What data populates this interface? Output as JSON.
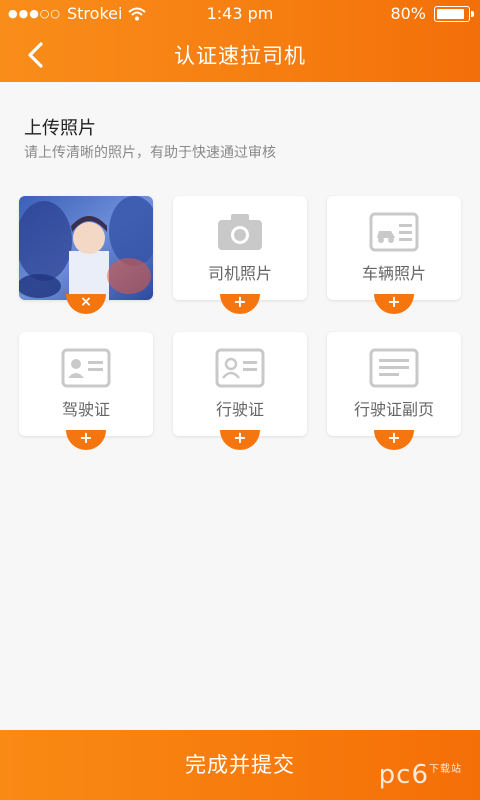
{
  "status": {
    "carrier": "Strokei",
    "time": "1:43 pm",
    "battery": "80%",
    "battery_level": 0.8
  },
  "nav": {
    "title": "认证速拉司机"
  },
  "upload": {
    "title": "上传照片",
    "subtitle": "请上传清晰的照片，有助于快速通过审核"
  },
  "tiles": [
    {
      "label": "",
      "badge": "×",
      "state": "uploaded"
    },
    {
      "label": "司机照片",
      "badge": "+"
    },
    {
      "label": "车辆照片",
      "badge": "+"
    },
    {
      "label": "驾驶证",
      "badge": "+"
    },
    {
      "label": "行驶证",
      "badge": "+"
    },
    {
      "label": "行驶证副页",
      "badge": "+"
    }
  ],
  "footer": {
    "submit_label": "完成并提交"
  },
  "watermark": {
    "text": "pc6",
    "sub": "下载站"
  },
  "colors": {
    "accent": "#f5760e",
    "background": "#f7f7f7"
  }
}
